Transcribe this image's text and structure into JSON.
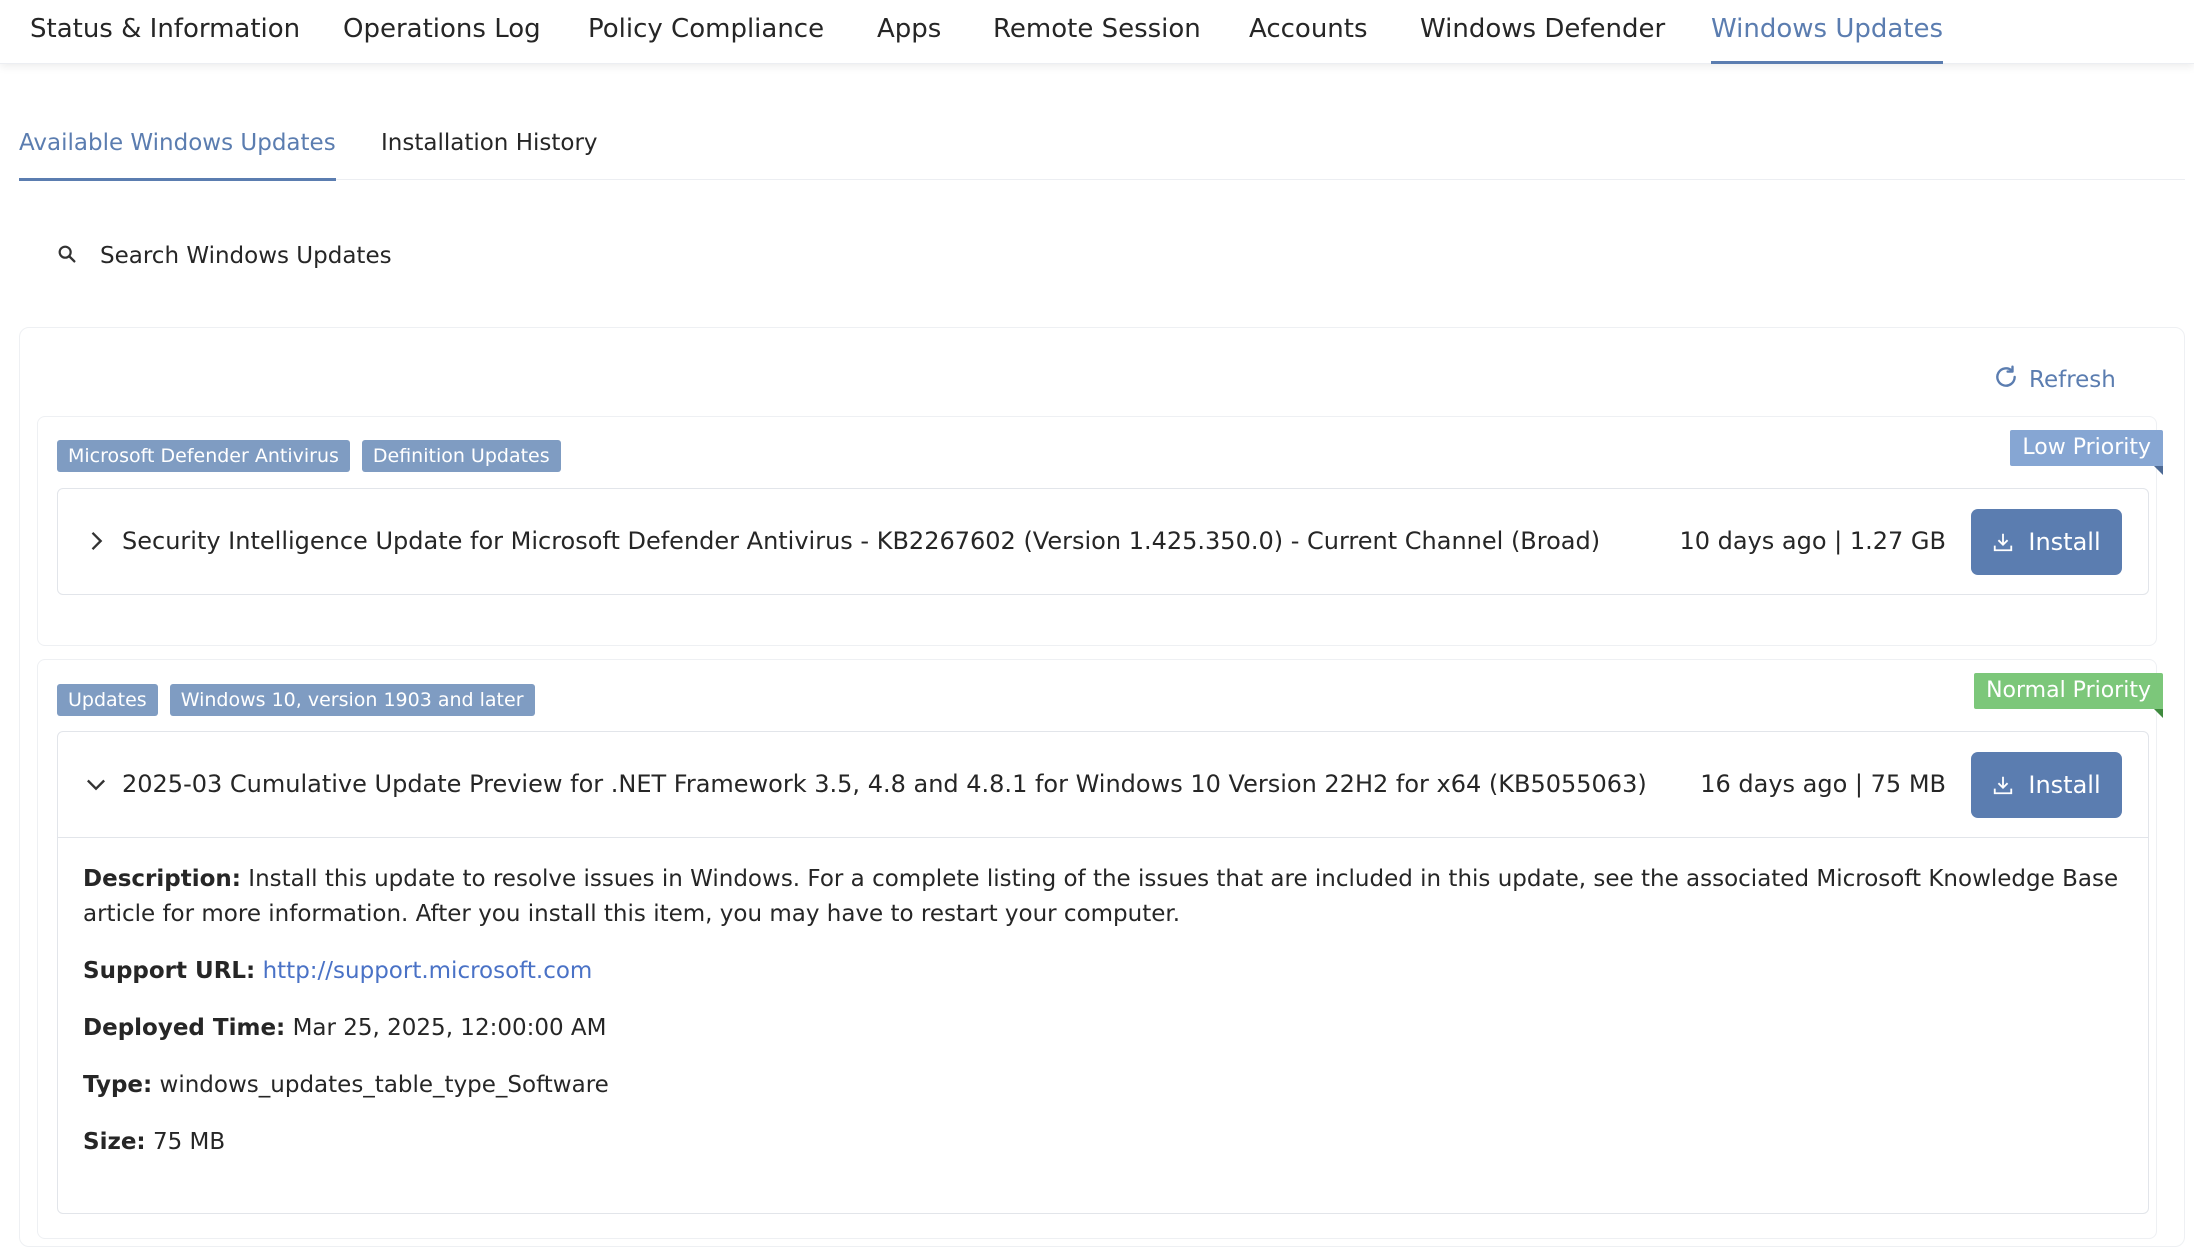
{
  "top_tabs": [
    {
      "label": "Status & Information"
    },
    {
      "label": "Operations Log"
    },
    {
      "label": "Policy Compliance"
    },
    {
      "label": "Apps"
    },
    {
      "label": "Remote Session"
    },
    {
      "label": "Accounts"
    },
    {
      "label": "Windows Defender"
    },
    {
      "label": "Windows Updates",
      "active": true
    }
  ],
  "sub_tabs": [
    {
      "label": "Available Windows Updates",
      "active": true
    },
    {
      "label": "Installation History"
    }
  ],
  "search": {
    "placeholder": "Search Windows Updates",
    "value": ""
  },
  "refresh_label": "Refresh",
  "colors": {
    "accent": "#5b7db0",
    "tag": "#7f9cc2",
    "low_priority": "#86a6d3",
    "normal_priority": "#7cc77a",
    "link": "#4a72c6"
  },
  "updates": [
    {
      "tags": [
        "Microsoft Defender Antivirus",
        "Definition Updates"
      ],
      "priority": "Low Priority",
      "title": "Security Intelligence Update for Microsoft Defender Antivirus - KB2267602 (Version 1.425.350.0) - Current Channel (Broad)",
      "meta": "10 days ago | 1.27 GB",
      "install_label": "Install",
      "expanded": false
    },
    {
      "tags": [
        "Updates",
        "Windows 10, version 1903 and later"
      ],
      "priority": "Normal Priority",
      "title": "2025-03 Cumulative Update Preview for .NET Framework 3.5, 4.8 and 4.8.1 for Windows 10 Version 22H2 for x64 (KB5055063)",
      "meta": "16 days ago | 75 MB",
      "install_label": "Install",
      "expanded": true,
      "details": {
        "description_label": "Description:",
        "description": "Install this update to resolve issues in Windows. For a complete listing of the issues that are included in this update, see the associated Microsoft Knowledge Base article for more information. After you install this item, you may have to restart your computer.",
        "support_url_label": "Support URL:",
        "support_url": "http://support.microsoft.com",
        "deployed_time_label": "Deployed Time:",
        "deployed_time": "Mar 25, 2025, 12:00:00 AM",
        "type_label": "Type:",
        "type": "windows_updates_table_type_Software",
        "size_label": "Size:",
        "size": "75 MB"
      }
    }
  ]
}
